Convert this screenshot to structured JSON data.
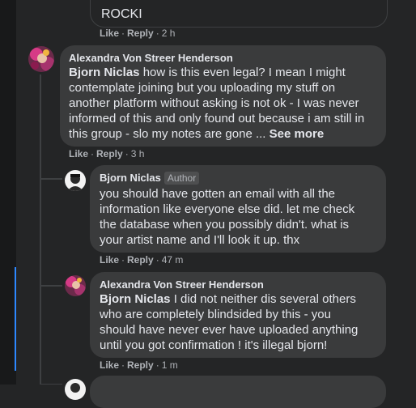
{
  "top_comment": {
    "text": "ROCKI",
    "actions": {
      "like": "Like",
      "reply": "Reply",
      "time": "2 h"
    }
  },
  "comment_1": {
    "author": "Alexandra Von Streer Henderson",
    "mention": "Bjorn Niclas",
    "lines": [
      " how is this even legal? I mean I might",
      "contemplate joining but you uploading my stuff on",
      "another platform without asking is not ok - I was never",
      "informed of this and only found out because i am still in",
      "this group - slo my notes are gone ... "
    ],
    "see_more": "See more",
    "actions": {
      "like": "Like",
      "reply": "Reply",
      "time": "3 h"
    }
  },
  "reply_1": {
    "author": "Bjorn Niclas",
    "badge": "Author",
    "lines": [
      "you should have gotten an email with all the",
      "information like everyone else did. let me check",
      "the database when you possibly didn't. what is",
      "your artist name and I'll look it up. thx"
    ],
    "actions": {
      "like": "Like",
      "reply": "Reply",
      "time": "47 m"
    }
  },
  "reply_2": {
    "author": "Alexandra Von Streer Henderson",
    "mention": "Bjorn Niclas",
    "lines": [
      " I did not neither dis several others",
      "who are completely blindsided by this - you",
      "should have never ever have uploaded anything",
      "until you got confirmation ! it's illegal bjorn!"
    ],
    "actions": {
      "like": "Like",
      "reply": "Reply",
      "time": "1 m"
    }
  },
  "colors": {
    "background": "#242526",
    "bubble": "#3a3b3c",
    "text": "#e4e6eb",
    "secondary_text": "#b0b3b8",
    "thread_highlight": "#2d88ff"
  }
}
